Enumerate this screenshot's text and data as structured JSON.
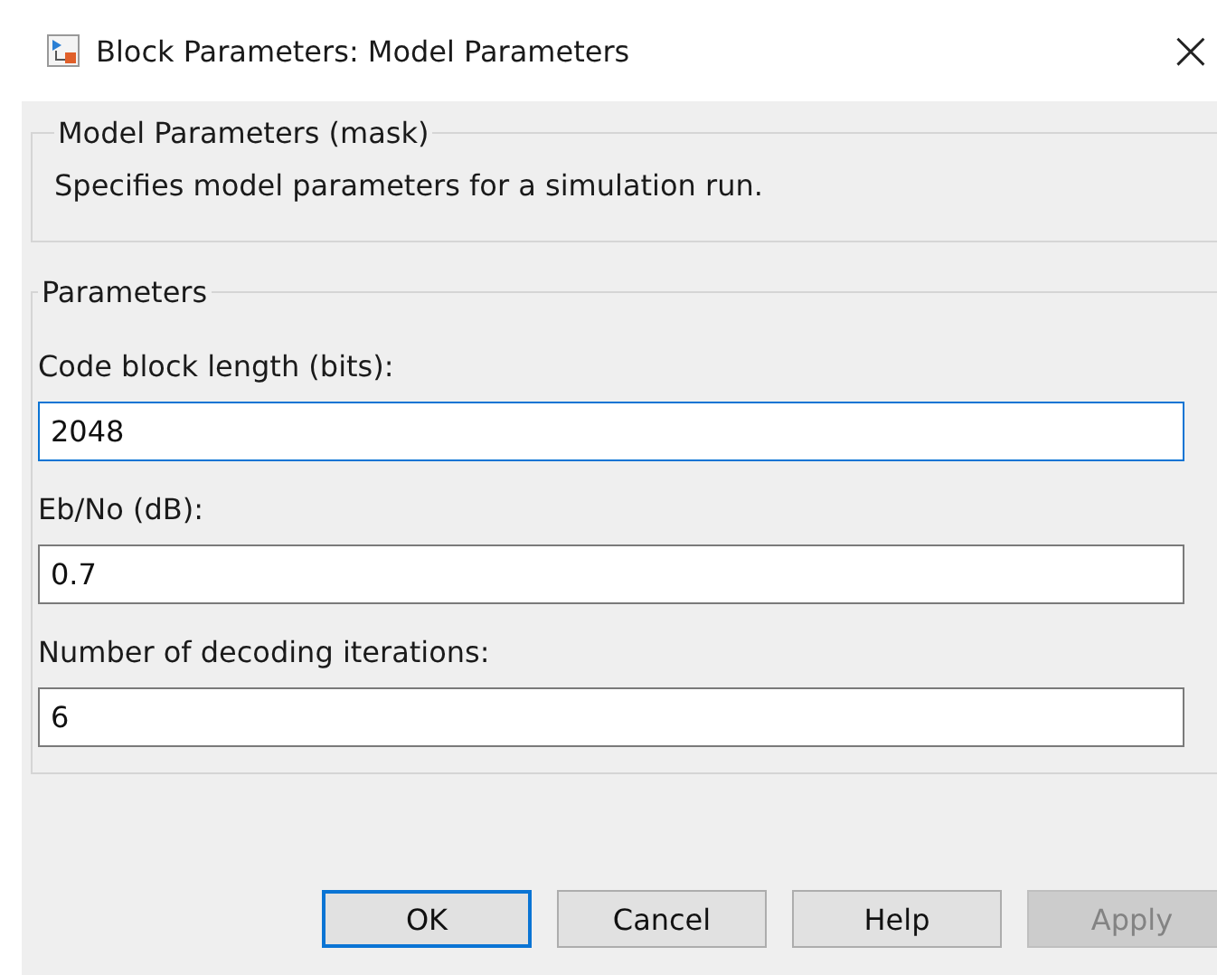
{
  "window": {
    "title": "Block Parameters: Model Parameters",
    "close": "×"
  },
  "description_group": {
    "title": "Model Parameters (mask)",
    "text": "Specifies model parameters for a simulation run."
  },
  "parameters_group": {
    "title": "Parameters",
    "fields": [
      {
        "label": "Code block length (bits):",
        "value": "2048",
        "focused": true
      },
      {
        "label": "Eb/No (dB):",
        "value": "0.7",
        "focused": false
      },
      {
        "label": "Number of decoding iterations:",
        "value": "6",
        "focused": false
      }
    ]
  },
  "buttons": [
    {
      "label": "OK",
      "default": true,
      "disabled": false
    },
    {
      "label": "Cancel",
      "default": false,
      "disabled": false
    },
    {
      "label": "Help",
      "default": false,
      "disabled": false
    },
    {
      "label": "Apply",
      "default": false,
      "disabled": true
    }
  ]
}
